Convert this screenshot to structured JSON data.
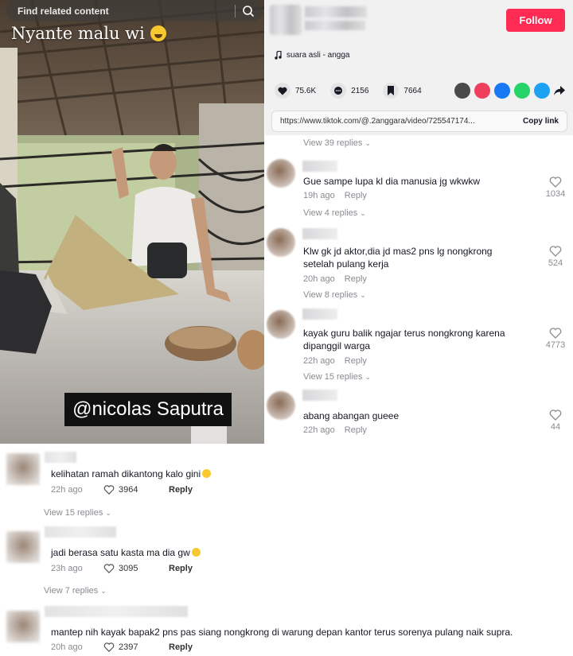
{
  "video": {
    "search_placeholder": "Find related content",
    "caption": "Nyante malu wi",
    "tag": "@nicolas Saputra"
  },
  "header": {
    "follow_label": "Follow",
    "music": "suara asli - angga"
  },
  "stats": {
    "likes": "75.6K",
    "comments": "2156",
    "saves": "7664"
  },
  "share": {
    "colors": [
      "#4a4a4a",
      "#ee3f5d",
      "#1877f2",
      "#25d366",
      "#1da1f2"
    ],
    "icons": [
      "embed-icon",
      "send-icon",
      "facebook-icon",
      "whatsapp-icon",
      "twitter-icon",
      "share-arrow-icon"
    ]
  },
  "link": {
    "url": "https://www.tiktok.com/@.2anggara/video/725547174...",
    "copy_label": "Copy link"
  },
  "right_comments": [
    {
      "text": "Gue sampe lupa kl dia manusia jg wkwkw",
      "time": "19h ago",
      "reply": "Reply",
      "replies": "View 4 replies",
      "likes": "1034"
    },
    {
      "text": "Klw gk jd aktor,dia jd mas2 pns lg nongkrong setelah pulang kerja",
      "time": "20h ago",
      "reply": "Reply",
      "replies": "View 8 replies",
      "likes": "524"
    },
    {
      "text": "kayak guru balik ngajar terus nongkrong karena dipanggil warga",
      "time": "22h ago",
      "reply": "Reply",
      "replies": "View 15 replies",
      "likes": "4773"
    },
    {
      "text": "abang abangan gueee",
      "time": "22h ago",
      "reply": "Reply",
      "replies": "",
      "likes": "44"
    }
  ],
  "right_top_replies": "View 39 replies",
  "bottom_comments": [
    {
      "text": "kelihatan ramah dikantong kalo gini",
      "time": "22h ago",
      "likes": "3964",
      "reply": "Reply",
      "replies": "View 15 replies"
    },
    {
      "text": "jadi berasa satu kasta ma dia gw",
      "time": "23h ago",
      "likes": "3095",
      "reply": "Reply",
      "replies": "View 7 replies"
    },
    {
      "text": "mantep nih kayak bapak2 pns pas siang nongkrong di warung depan kantor terus sorenya pulang naik supra.",
      "time": "20h ago",
      "likes": "2397",
      "reply": "Reply",
      "replies": ""
    }
  ]
}
